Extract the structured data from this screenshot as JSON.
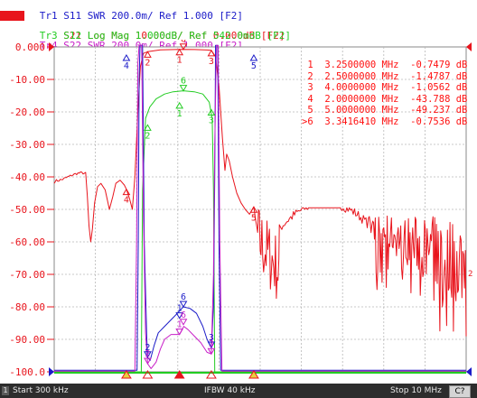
{
  "traces": [
    {
      "id": "Tr1",
      "param": "S11",
      "format": "SWR",
      "scale": "200.0m/",
      "ref": "Ref 1.000",
      "tag": "[F2]",
      "color": "#1b1bc8",
      "active": false
    },
    {
      "id": "Tr2",
      "param": "S21",
      "format": "Log Mag",
      "scale": "10.00dB/",
      "ref": "Ref 0.000dB",
      "tag": "[F2]",
      "color": "#e8141c",
      "active": true
    },
    {
      "id": "Tr3",
      "param": "S12",
      "format": "Log Mag",
      "scale": "1.000dB/",
      "ref": "Ref 542.0mdB",
      "tag": "[F2]",
      "color": "#22cc22",
      "active": false
    },
    {
      "id": "Tr4",
      "param": "S22",
      "format": "SWR",
      "scale": "200.0m/",
      "ref": "Ref 1.000",
      "tag": "[F2]",
      "color": "#c81ec8",
      "active": false
    }
  ],
  "axis": {
    "y_ticks": [
      "0.000",
      "-10.00",
      "-20.00",
      "-30.00",
      "-40.00",
      "-50.00",
      "-60.00",
      "-70.00",
      "-80.00",
      "-90.00",
      "-100.0"
    ],
    "ylim": [
      -100,
      0
    ],
    "xlim_mhz": [
      0.3,
      10
    ],
    "right_channel_label": "2"
  },
  "marker_table": [
    {
      "num": "1",
      "freq": "3.2500000 MHz",
      "value": "-0.7479 dB"
    },
    {
      "num": "2",
      "freq": "2.5000000 MHz",
      "value": "-1.4787 dB"
    },
    {
      "num": "3",
      "freq": "4.0000000 MHz",
      "value": "-1.0562 dB"
    },
    {
      "num": "4",
      "freq": "2.0000000 MHz",
      "value": "-43.788 dB"
    },
    {
      "num": "5",
      "freq": "5.0000000 MHz",
      "value": "-49.237 dB"
    },
    {
      "num": ">6",
      "freq": "3.3416410 MHz",
      "value": "-0.7536 dB"
    }
  ],
  "markers": {
    "tr2": [
      {
        "label": "1",
        "freq": 3.25,
        "db": -0.75
      },
      {
        "label": "2",
        "freq": 2.5,
        "db": -1.48
      },
      {
        "label": "3",
        "freq": 4.0,
        "db": -1.06
      },
      {
        "label": "4",
        "freq": 2.0,
        "db": -43.79
      },
      {
        "label": "5",
        "freq": 5.0,
        "db": -49.24
      },
      {
        "label": "6",
        "freq": 3.3416,
        "db": -0.75
      }
    ],
    "tr3": [
      {
        "label": "1",
        "freq": 3.25,
        "db": -17.2
      },
      {
        "label": "2",
        "freq": 2.5,
        "db": -24.0
      },
      {
        "label": "3",
        "freq": 4.0,
        "db": -19.3
      },
      {
        "label": "6",
        "freq": 3.3416,
        "db": -13.5
      }
    ],
    "tr1": [
      {
        "label": "1",
        "freq": 3.25,
        "db": -83.5
      },
      {
        "label": "2",
        "freq": 2.5,
        "db": -95.5
      },
      {
        "label": "3",
        "freq": 4.0,
        "db": -92.5
      },
      {
        "label": "4",
        "freq": 2.0,
        "db": -2.5
      },
      {
        "label": "5",
        "freq": 5.0,
        "db": -2.5
      },
      {
        "label": "6",
        "freq": 3.3416,
        "db": -80.0
      }
    ],
    "tr4": [
      {
        "label": "1",
        "freq": 3.25,
        "db": -88.5
      },
      {
        "label": "2",
        "freq": 2.5,
        "db": -97.5
      },
      {
        "label": "3",
        "freq": 4.0,
        "db": -94.5
      },
      {
        "label": "6",
        "freq": 3.3416,
        "db": -85.5
      }
    ]
  },
  "status": {
    "indicator": "1",
    "start": "Start 300 kHz",
    "ifbw": "IFBW 40 kHz",
    "stop": "Stop 10 MHz",
    "cont": "C?"
  }
}
